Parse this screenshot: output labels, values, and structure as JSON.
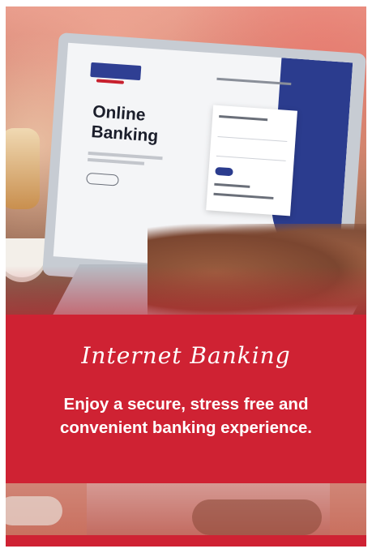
{
  "hero": {
    "screen_heading_line1": "Online",
    "screen_heading_line2": "Banking"
  },
  "banner": {
    "title": "Internet Banking",
    "description": "Enjoy a secure, stress free and convenient banking experience."
  },
  "colors": {
    "banner_red": "#cf2233",
    "screen_navy": "#2b3c8e"
  }
}
